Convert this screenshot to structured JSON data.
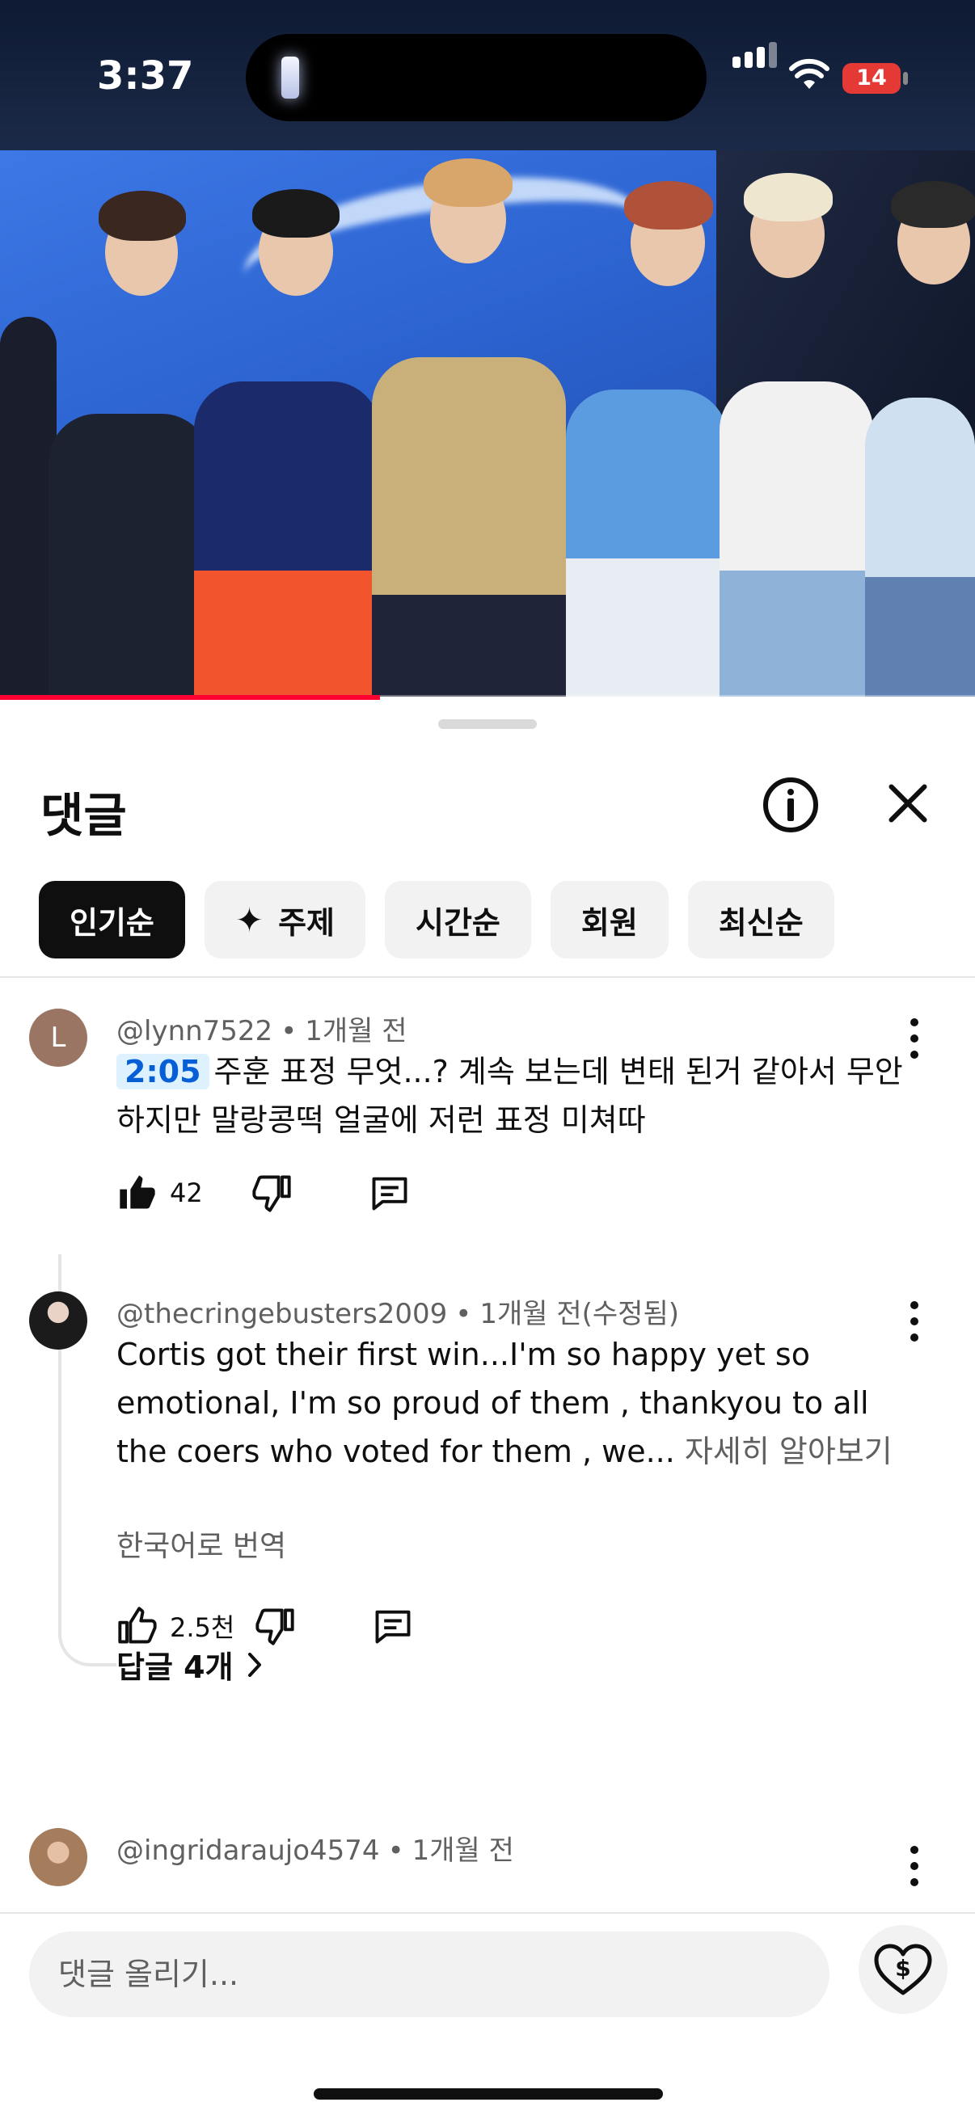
{
  "status_bar": {
    "time": "3:37",
    "battery": "14"
  },
  "sheet": {
    "title": "댓글",
    "chips": [
      {
        "label": "인기순",
        "active": true
      },
      {
        "label": "주제",
        "icon": "sparkle-icon"
      },
      {
        "label": "시간순"
      },
      {
        "label": "회원"
      },
      {
        "label": "최신순"
      }
    ]
  },
  "comments": [
    {
      "author": "@lynn7522",
      "time": "1개월 전",
      "avatar_letter": "L",
      "timestamp_link": "2:05",
      "text": "주훈 표정 무엇...? 계속 보는데 변태 된거 같아서 무안하지만 말랑콩떡 얼굴에 저런 표정 미쳐따",
      "likes": "42"
    },
    {
      "author": "@thecringebusters2009",
      "time": "1개월 전(수정됨)",
      "text": "Cortis got their first win...I'm so happy yet so emotional, I'm so proud of them , thankyou to all the coers who voted for them , we...",
      "read_more": "자세히 알아보기",
      "translate": "한국어로 번역",
      "likes": "2.5천",
      "replies": "답글 4개"
    },
    {
      "author": "@ingridaraujo4574",
      "time": "1개월 전"
    }
  ],
  "composer": {
    "placeholder": "댓글 올리기..."
  },
  "video": {
    "progress": 0.39
  }
}
